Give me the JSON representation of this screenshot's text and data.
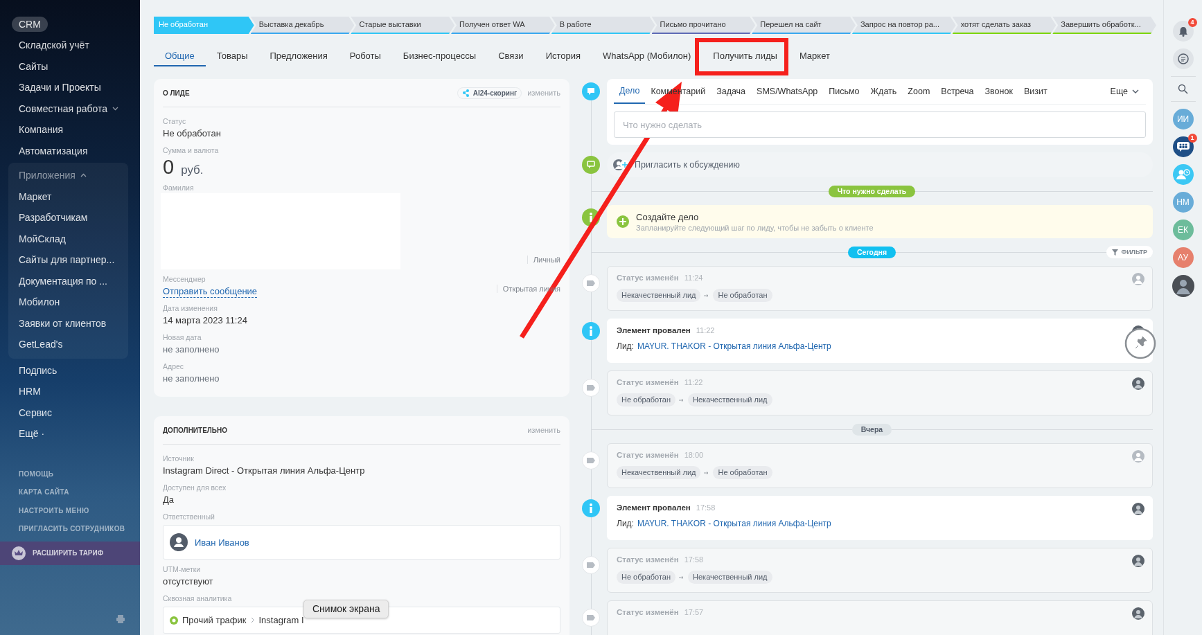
{
  "sidebar": {
    "items": [
      {
        "kind": "item",
        "label": "CRM",
        "selected": true
      },
      {
        "kind": "item",
        "label": "Складской учёт",
        "selected": false
      },
      {
        "kind": "item",
        "label": "Сайты",
        "selected": false
      },
      {
        "kind": "item",
        "label": "Задачи и Проекты",
        "selected": false
      },
      {
        "kind": "folder",
        "label": "Совместная работа",
        "selected": false,
        "expanded": false
      },
      {
        "kind": "item",
        "label": "Компания",
        "selected": false
      },
      {
        "kind": "item",
        "label": "Автоматизация",
        "selected": false
      },
      {
        "kind": "group",
        "label": "Приложения",
        "selected": false,
        "expanded": true,
        "children": [
          {
            "label": "Маркет"
          },
          {
            "label": "Разработчикам"
          },
          {
            "label": "МойСклад"
          },
          {
            "label": "Сайты для партнер..."
          },
          {
            "label": "Документация по ..."
          },
          {
            "label": "Мобилон"
          },
          {
            "label": "Заявки от клиентов"
          },
          {
            "label": "GetLead's"
          }
        ]
      },
      {
        "kind": "item",
        "label": "Подпись",
        "selected": false
      },
      {
        "kind": "item",
        "label": "HRM",
        "selected": false
      },
      {
        "kind": "item",
        "label": "Сервис",
        "selected": false
      },
      {
        "kind": "item",
        "label": "Ещё ·",
        "selected": false
      }
    ],
    "links": [
      "ПОМОЩЬ",
      "КАРТА САЙТА",
      "НАСТРОИТЬ МЕНЮ",
      "ПРИГЛАСИТЬ СОТРУДНИКОВ"
    ],
    "upgrade": "РАСШИРИТЬ ТАРИФ"
  },
  "stages": [
    {
      "label": "Не обработан",
      "selected": true,
      "color": "#2fc6f6"
    },
    {
      "label": "Выставка декабрь",
      "selected": false,
      "color": "#39a8ef"
    },
    {
      "label": "Старые выставки",
      "selected": false,
      "color": "#2fc6f6"
    },
    {
      "label": "Получен ответ WA",
      "selected": false,
      "color": "#39a8ef"
    },
    {
      "label": "В работе",
      "selected": false,
      "color": "#2fc6f6"
    },
    {
      "label": "Письмо прочитано",
      "selected": false,
      "color": "#5e6ab5"
    },
    {
      "label": "Перешел на сайт",
      "selected": false,
      "color": "#39a8ef"
    },
    {
      "label": "Запрос на повтор ра...",
      "selected": false,
      "color": "#2fc6f6"
    },
    {
      "label": "хотят сделать заказ",
      "selected": false,
      "color": "#7bd500"
    },
    {
      "label": "Завершить обработк...",
      "selected": false,
      "color": "#7bd500"
    }
  ],
  "tabs": [
    {
      "label": "Общие",
      "selected": true
    },
    {
      "label": "Товары",
      "selected": false
    },
    {
      "label": "Предложения",
      "selected": false
    },
    {
      "label": "Роботы",
      "selected": false
    },
    {
      "label": "Бизнес-процессы",
      "selected": false
    },
    {
      "label": "Связи",
      "selected": false
    },
    {
      "label": "История",
      "selected": false
    },
    {
      "label": "WhatsApp (Мобилон)",
      "selected": false
    },
    {
      "label": "Получить лиды",
      "selected": false
    },
    {
      "label": "Маркет",
      "selected": false
    }
  ],
  "lead_card": {
    "title": "О ЛИДЕ",
    "scoring": "AI24-скоринг",
    "edit": "изменить",
    "fields": [
      {
        "kind": "text",
        "label": "Статус",
        "value": "Не обработан"
      },
      {
        "kind": "money",
        "label": "Сумма и валюта",
        "amount": "0",
        "currency": "руб."
      },
      {
        "kind": "hidden",
        "label": "Фамилия",
        "note": "Личный"
      },
      {
        "kind": "link",
        "label": "Мессенджер",
        "value": "Отправить сообщение",
        "note": "Открытая линия"
      },
      {
        "kind": "text",
        "label": "Дата изменения",
        "value": "14 марта 2023 11:24"
      },
      {
        "kind": "empty",
        "label": "Новая дата",
        "value": "не заполнено"
      },
      {
        "kind": "empty",
        "label": "Адрес",
        "value": "не заполнено"
      }
    ]
  },
  "extra_card": {
    "title": "ДОПОЛНИТЕЛЬНО",
    "edit": "изменить",
    "fields": [
      {
        "kind": "text",
        "label": "Источник",
        "value": "Instagram Direct - Открытая линия Альфа-Центр"
      },
      {
        "kind": "text",
        "label": "Доступен для всех",
        "value": "Да"
      },
      {
        "kind": "person",
        "label": "Ответственный",
        "value": "Иван Иванов"
      },
      {
        "kind": "text",
        "label": "UTM-метки",
        "value": "отсутствуют"
      },
      {
        "kind": "analytics",
        "label": "Сквозная аналитика",
        "value": "Прочий трафик",
        "next": "Instagram I"
      }
    ]
  },
  "activity": {
    "tabs": [
      {
        "label": "Дело",
        "selected": true
      },
      {
        "label": "Комментарий",
        "selected": false
      },
      {
        "label": "Задача",
        "selected": false
      },
      {
        "label": "SMS/WhatsApp",
        "selected": false
      },
      {
        "label": "Письмо",
        "selected": false
      },
      {
        "label": "Ждать",
        "selected": false
      },
      {
        "label": "Zoom",
        "selected": false
      },
      {
        "label": "Встреча",
        "selected": false
      },
      {
        "label": "Звонок",
        "selected": false
      },
      {
        "label": "Визит",
        "selected": false
      }
    ],
    "more": "Еще",
    "placeholder": "Что нужно сделать"
  },
  "invite": "Пригласить к обсуждению",
  "timeline": [
    {
      "kind": "divider",
      "label": "Что нужно сделать",
      "color": "#8ac43f"
    },
    {
      "kind": "todo",
      "title": "Создайте дело",
      "hint": "Запланируйте следующий шаг по лиду, чтобы не забыть о клиенте"
    },
    {
      "kind": "divider",
      "label": "Сегодня",
      "color": "#11c0f0",
      "filter": "ФИЛЬТР"
    },
    {
      "kind": "status",
      "title": "Статус изменён",
      "time": "11:24",
      "from": "Некачественный лид",
      "to": "Не обработан",
      "photo_avatar": false
    },
    {
      "kind": "failed",
      "title": "Элемент провален",
      "time": "11:22",
      "prefix": "Лид:",
      "link": "MAYUR. THAKOR - Открытая линия Альфа-Центр",
      "photo_avatar": true,
      "pinned": true
    },
    {
      "kind": "status",
      "title": "Статус изменён",
      "time": "11:22",
      "from": "Не обработан",
      "to": "Некачественный лид",
      "photo_avatar": true
    },
    {
      "kind": "divider",
      "label": "Вчера",
      "color": "#dfe5e8"
    },
    {
      "kind": "status",
      "title": "Статус изменён",
      "time": "18:00",
      "from": "Некачественный лид",
      "to": "Не обработан",
      "photo_avatar": false
    },
    {
      "kind": "failed",
      "title": "Элемент провален",
      "time": "17:58",
      "prefix": "Лид:",
      "link": "MAYUR. THAKOR - Открытая линия Альфа-Центр",
      "photo_avatar": true,
      "pinned": false
    },
    {
      "kind": "status",
      "title": "Статус изменён",
      "time": "17:58",
      "from": "Не обработан",
      "to": "Некачественный лид",
      "photo_avatar": true
    },
    {
      "kind": "status",
      "title": "Статус изменён",
      "time": "17:57",
      "photo_avatar": true
    }
  ],
  "right_bar": {
    "notifications": "4",
    "contacts": [
      {
        "kind": "initials",
        "label": "ИИ",
        "color": "#68acd8"
      },
      {
        "kind": "group-chat",
        "badge": "1",
        "color": "#1f4f86"
      },
      {
        "kind": "schedule",
        "color": "#3cc8f4"
      },
      {
        "kind": "initials",
        "label": "НМ",
        "color": "#68acd8"
      },
      {
        "kind": "initials",
        "label": "ЕК",
        "color": "#6dbc9b"
      },
      {
        "kind": "initials",
        "label": "АУ",
        "color": "#e6806d"
      },
      {
        "kind": "photo",
        "color": "#4a4f55"
      }
    ]
  },
  "tooltip": "Снимок экрана"
}
